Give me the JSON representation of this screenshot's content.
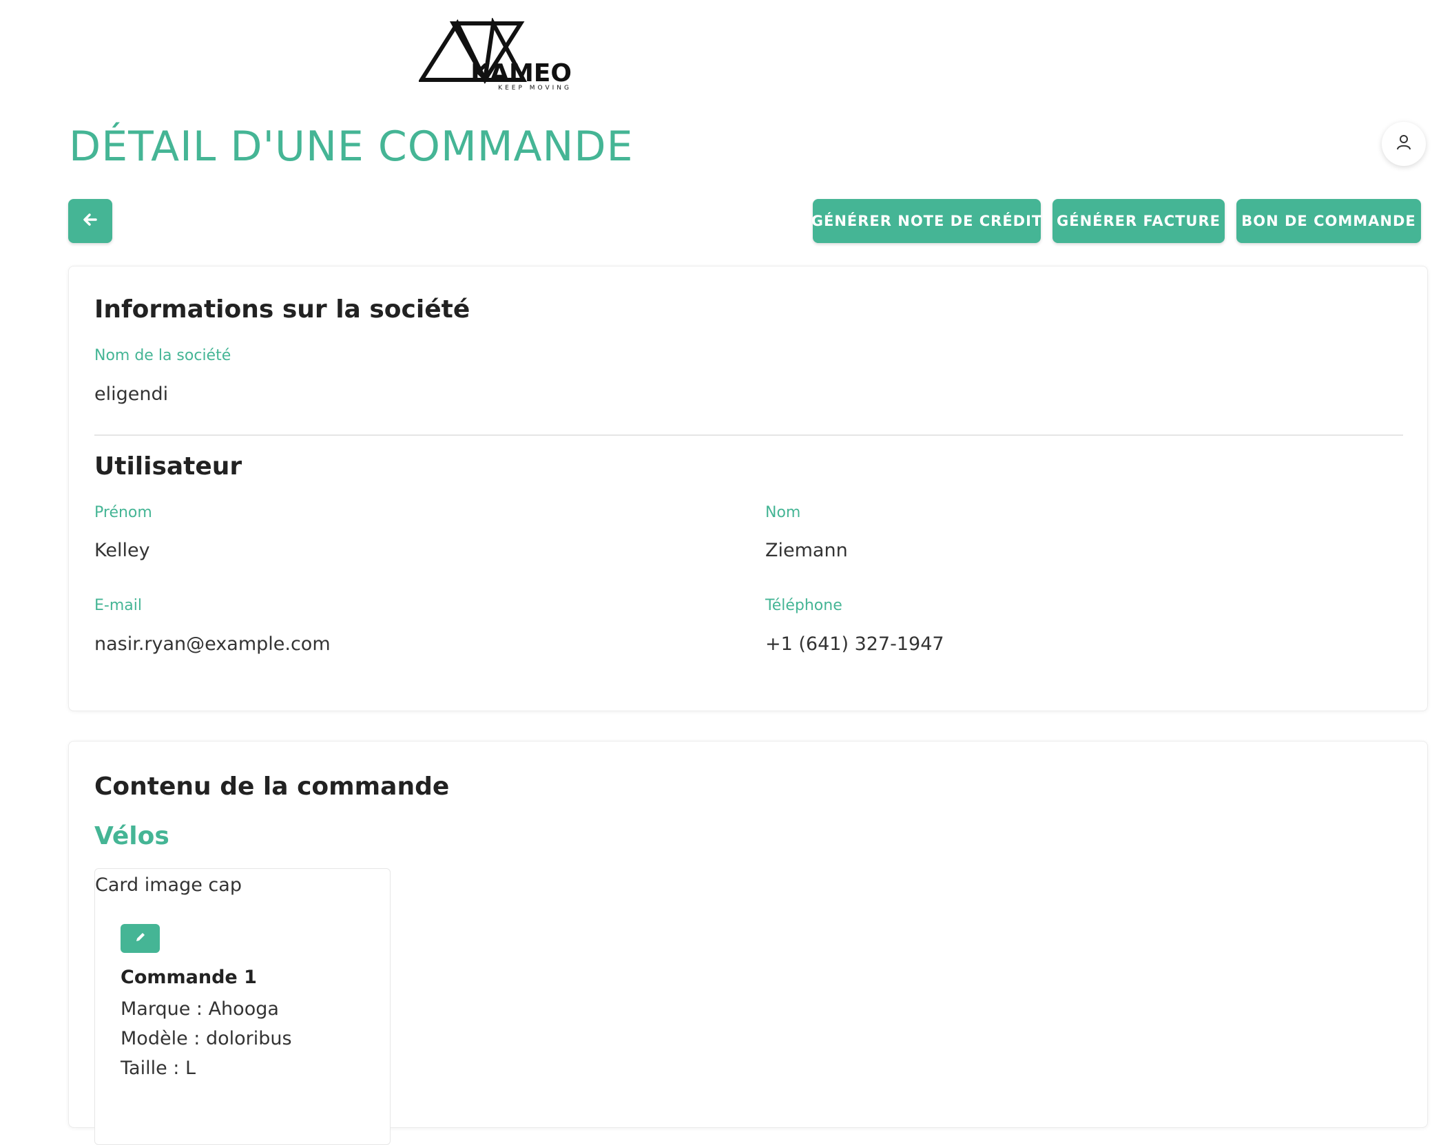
{
  "logo": {
    "brand": "KAMEO",
    "tagline": "KEEP MOVING"
  },
  "page": {
    "title": "DÉTAIL D'UNE COMMANDE"
  },
  "toolbar": {
    "credit_note_label": "GÉNÉRER NOTE DE CRÉDIT",
    "invoice_label": "GÉNÉRER FACTURE",
    "purchase_order_label": "BON DE COMMANDE"
  },
  "company": {
    "section_title": "Informations sur la société",
    "name_label": "Nom de la société",
    "name_value": "eligendi"
  },
  "user": {
    "section_title": "Utilisateur",
    "first_name_label": "Prénom",
    "first_name_value": "Kelley",
    "last_name_label": "Nom",
    "last_name_value": "Ziemann",
    "email_label": "E-mail",
    "email_value": "nasir.ryan@example.com",
    "phone_label": "Téléphone",
    "phone_value": "+1 (641) 327-1947"
  },
  "order": {
    "section_title": "Contenu de la commande",
    "bikes_title": "Vélos",
    "bike_card": {
      "image_alt": "Card image cap",
      "title": "Commande 1",
      "brand": "Marque : Ahooga",
      "model": "Modèle : doloribus",
      "size": "Taille : L"
    }
  },
  "icons": {
    "back": "arrow-left-icon",
    "user": "user-icon",
    "edit": "pencil-icon"
  },
  "colors": {
    "accent": "#45b595",
    "text": "#222222",
    "background": "#ffffff"
  }
}
